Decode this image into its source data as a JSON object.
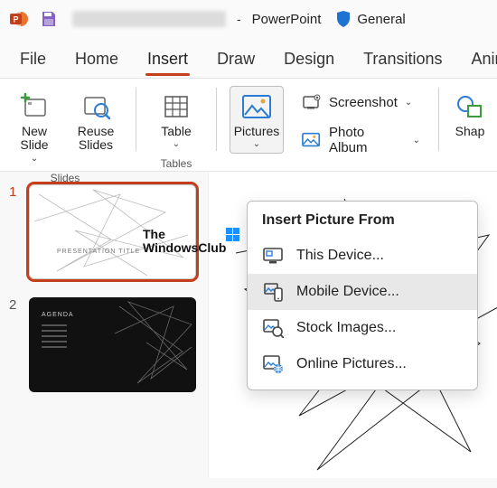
{
  "titlebar": {
    "app_label": "PowerPoint",
    "sensitivity_label": "General"
  },
  "tabs": {
    "file": "File",
    "home": "Home",
    "insert": "Insert",
    "draw": "Draw",
    "design": "Design",
    "transitions": "Transitions",
    "animations": "Anim"
  },
  "ribbon": {
    "new_slide": "New\nSlide",
    "reuse_slides": "Reuse\nSlides",
    "table": "Table",
    "pictures": "Pictures",
    "screenshot": "Screenshot",
    "photo_album": "Photo Album",
    "shapes": "Shap",
    "group_slides": "Slides",
    "group_tables": "Tables"
  },
  "dropdown": {
    "header": "Insert Picture From",
    "this_device": "This Device...",
    "mobile_device": "Mobile Device...",
    "stock_images": "Stock Images...",
    "online_pictures": "Online Pictures..."
  },
  "thumbs": {
    "n1": "1",
    "n2": "2",
    "slide1_title": "PRESENTATION TITLE",
    "slide2_title": "AGENDA"
  },
  "watermark": {
    "line1": "The",
    "line2": "WindowsClub"
  },
  "separator": "-"
}
